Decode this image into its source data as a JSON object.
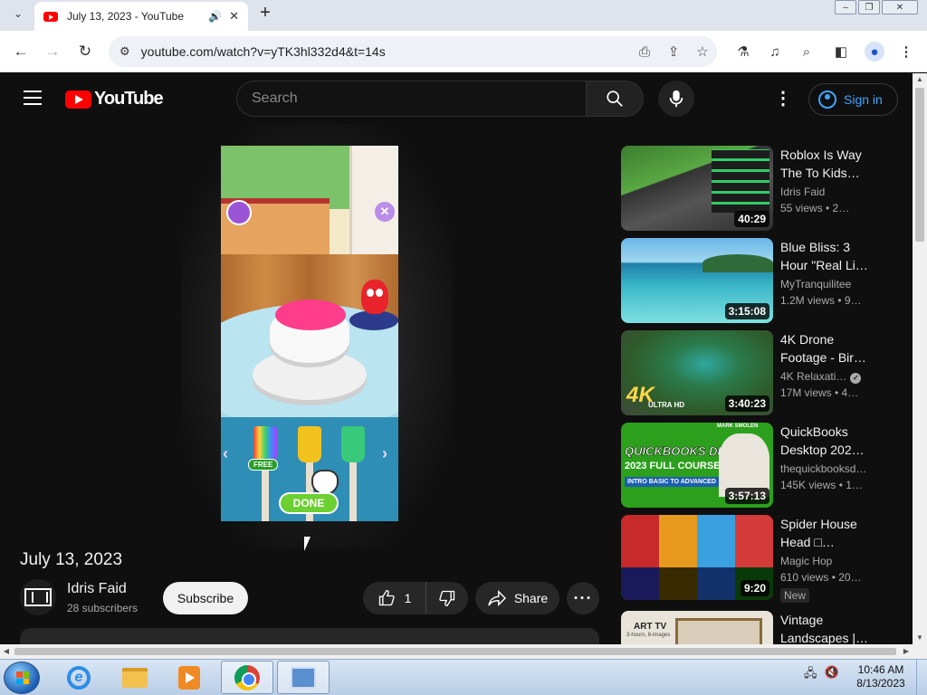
{
  "browser": {
    "tab": {
      "title": "July 13, 2023 - YouTube"
    },
    "url": "youtube.com/watch?v=yTK3hl332d4&t=14s"
  },
  "youtube": {
    "logo_text": "YouTube",
    "search_placeholder": "Search",
    "signin_label": "Sign in"
  },
  "video": {
    "title": "July 13, 2023",
    "channel_name": "Idris Faid",
    "subscribers": "28 subscribers",
    "subscribe_label": "Subscribe",
    "like_count": "1",
    "share_label": "Share",
    "game": {
      "free_label": "FREE",
      "done_label": "DONE"
    }
  },
  "recommendations": [
    {
      "title": "Roblox Is Way The To Kids…",
      "channel": "Idris Faid",
      "meta": "55 views  • 2…",
      "duration": "40:29"
    },
    {
      "title": "Blue Bliss: 3 Hour \"Real Li…",
      "channel": "MyTranquilitee",
      "meta": "1.2M views  • 9…",
      "duration": "3:15:08"
    },
    {
      "title": "4K Drone Footage - Bir…",
      "channel": "4K Relaxati…",
      "meta": "17M views  • 4…",
      "duration": "3:40:23",
      "verified": true,
      "thumb_text": "4K",
      "thumb_subtext": "ULTRA HD"
    },
    {
      "title": "QuickBooks Desktop 202…",
      "channel": "thequickbooksd…",
      "meta": "145K views  • 1…",
      "duration": "3:57:13",
      "thumb_lines": [
        "QUICKBOOKS DESKTOP",
        "2023 FULL COURSE",
        "INTRO BASIC TO ADVANCED",
        "MARK SMOLEN"
      ]
    },
    {
      "title": "Spider House Head □…",
      "channel": "Magic Hop",
      "meta": "610 views  • 20…",
      "duration": "9:20",
      "badge": "New"
    },
    {
      "title": "Vintage Landscapes |…",
      "thumb_text": "ART TV",
      "thumb_subtext": "3-hours, 8-images"
    }
  ],
  "taskbar": {
    "clock_time": "10:46 AM",
    "clock_date": "8/13/2023"
  }
}
